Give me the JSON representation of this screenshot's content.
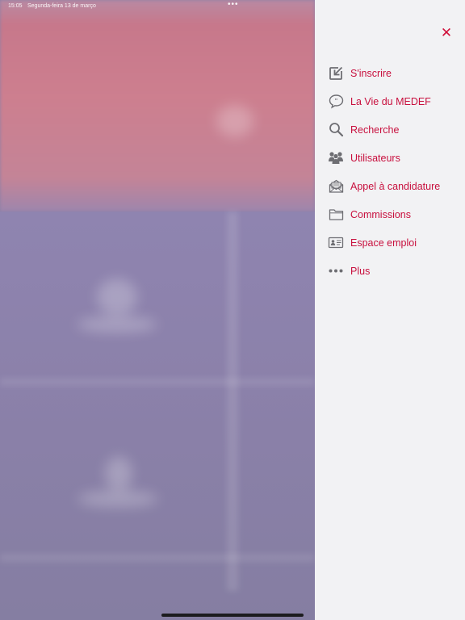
{
  "status_bar": {
    "time": "15:05",
    "date": "Segunda-feira 13 de março"
  },
  "menu": {
    "close_icon": "close-icon",
    "items": [
      {
        "label": "S'inscrire",
        "icon": "sign-in-icon"
      },
      {
        "label": "La Vie du MEDEF",
        "icon": "speech-bubble-icon"
      },
      {
        "label": "Recherche",
        "icon": "search-icon"
      },
      {
        "label": "Utilisateurs",
        "icon": "users-icon"
      },
      {
        "label": "Appel à candidature",
        "icon": "envelope-icon"
      },
      {
        "label": "Commissions",
        "icon": "folder-icon"
      },
      {
        "label": "Espace emploi",
        "icon": "id-card-icon"
      },
      {
        "label": "Plus",
        "icon": "more-dots-icon"
      }
    ]
  },
  "colors": {
    "accent": "#c8103e",
    "menu_background": "#f2f2f4",
    "icon_gray": "#6e6e73"
  }
}
